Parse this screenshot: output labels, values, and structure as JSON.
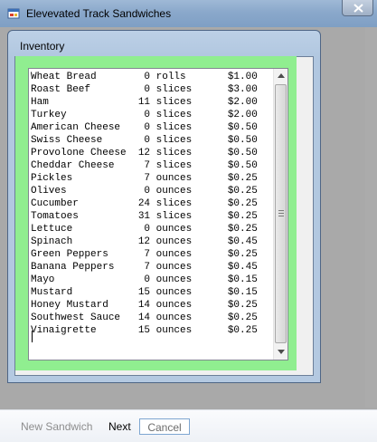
{
  "window": {
    "title": "Elevevated Track Sandwiches",
    "close_icon": "close-x-icon",
    "app_icon": "app-window-icon"
  },
  "inventory_window": {
    "title": "Inventory"
  },
  "inventory_lines": [
    "Wheat Bread        0 rolls       $1.00",
    "Roast Beef         0 slices      $3.00",
    "Ham               11 slices      $2.00",
    "Turkey             0 slices      $2.00",
    "American Cheese    0 slices      $0.50",
    "Swiss Cheese       0 slices      $0.50",
    "Provolone Cheese  12 slices      $0.50",
    "Cheddar Cheese     7 slices      $0.50",
    "Pickles            7 ounces      $0.25",
    "Olives             0 ounces      $0.25",
    "Cucumber          24 slices      $0.25",
    "Tomatoes          31 slices      $0.25",
    "Lettuce            0 ounces      $0.25",
    "Spinach           12 ounces      $0.45",
    "Green Peppers      7 ounces      $0.25",
    "Banana Peppers     7 ounces      $0.45",
    "Mayo               0 ounces      $0.15",
    "Mustard           15 ounces      $0.15",
    "Honey Mustard     14 ounces      $0.25",
    "Southwest Sauce   14 ounces      $0.25",
    "Vinaigrette       15 ounces      $0.25"
  ],
  "menu": {
    "new_sandwich": "New Sandwich",
    "next": "Next",
    "cancel": "Cancel"
  },
  "colors": {
    "panel_green": "#90ee90",
    "mdi_background": "#a9a9a9"
  }
}
